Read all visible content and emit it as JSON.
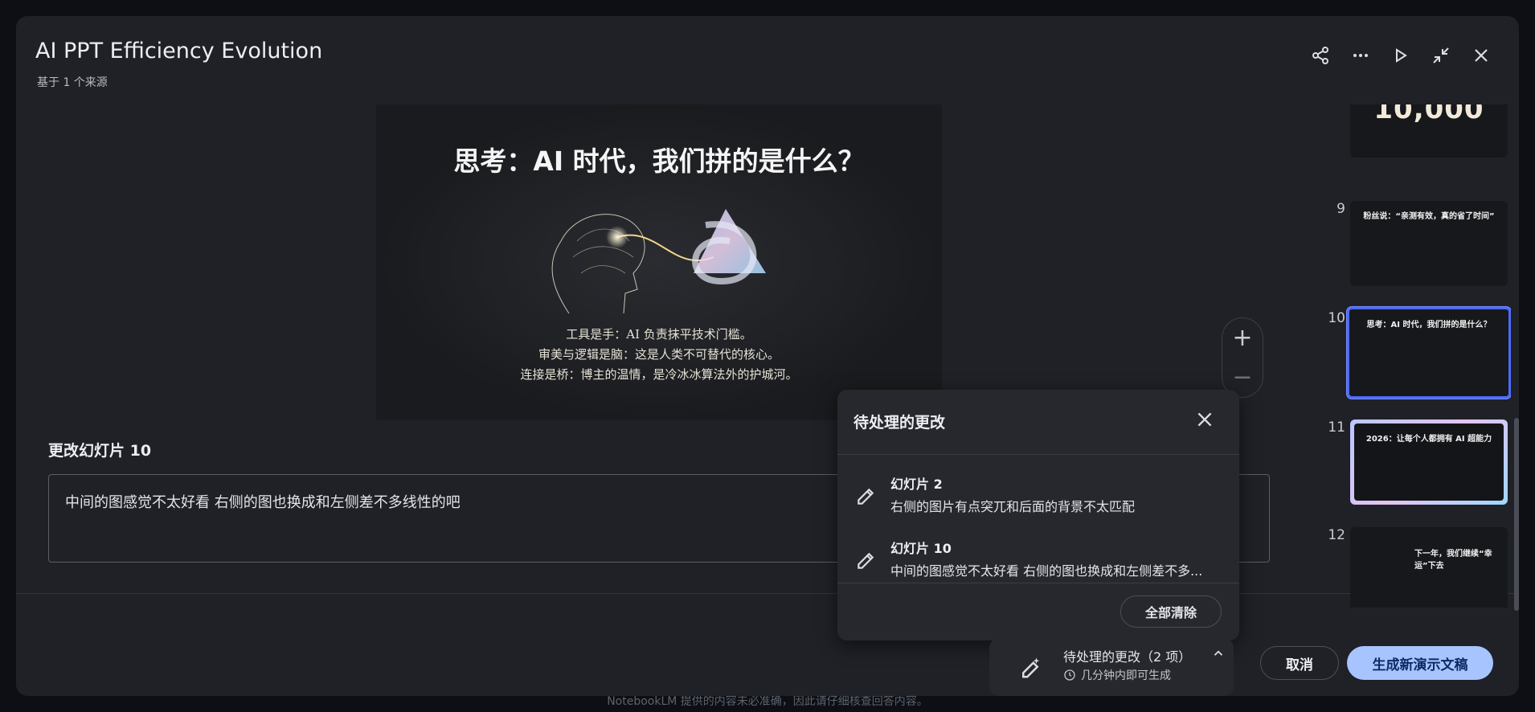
{
  "header": {
    "title": "AI PPT Efficiency Evolution",
    "subtitle": "基于 1 个来源",
    "actions": [
      "share-icon",
      "more-icon",
      "play-icon",
      "collapse-icon",
      "close-icon"
    ]
  },
  "slide": {
    "title": "思考：AI 时代，我们拼的是什么？",
    "lines": [
      "工具是手：AI 负责抹平技术门槛。",
      "审美与逻辑是脑：这是人类不可替代的核心。",
      "连接是桥：博主的温情，是冷冰冰算法外的护城河。"
    ]
  },
  "editor": {
    "label": "更改幻灯片 10",
    "value": "中间的图感觉不太好看 右侧的图也换成和左侧差不多线性的吧"
  },
  "zoom": {
    "in": "+",
    "out": "−"
  },
  "thumbnails": [
    {
      "num": "",
      "title": "10,000"
    },
    {
      "num": "9",
      "title": "粉丝说：“亲测有效，真的省了时间”"
    },
    {
      "num": "10",
      "title": "思考：AI 时代，我们拼的是什么？",
      "selected": true
    },
    {
      "num": "11",
      "title": "2026：让每个人都拥有 AI 超能力"
    },
    {
      "num": "12",
      "title": "下一年，我们继续“幸运”下去"
    }
  ],
  "pending_popover": {
    "title": "待处理的更改",
    "items": [
      {
        "title": "幻灯片 2",
        "desc": "右侧的图片有点突兀和后面的背景不太匹配"
      },
      {
        "title": "幻灯片 10",
        "desc": "中间的图感觉不太好看 右侧的图也换成和左侧差不多..."
      }
    ],
    "clear_all": "全部清除"
  },
  "pending_bar": {
    "title": "待处理的更改（2 项）",
    "sub": "几分钟内即可生成"
  },
  "footer": {
    "cancel": "取消",
    "generate": "生成新演示文稿",
    "disclaimer": "NotebookLM 提供的内容未必准确，因此请仔细核查回答内容。"
  },
  "colors": {
    "accent": "#a8c4ff",
    "selected_border": "#4d6bfe",
    "bg": "#1f2127"
  }
}
